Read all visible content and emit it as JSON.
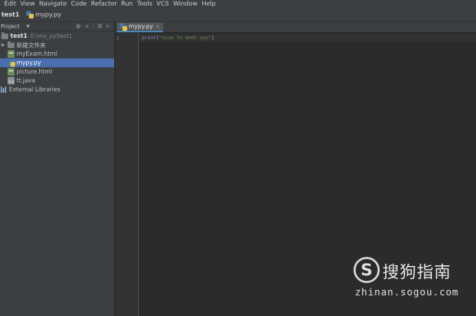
{
  "menu": [
    "Edit",
    "View",
    "Navigate",
    "Code",
    "Refactor",
    "Run",
    "Tools",
    "VCS",
    "Window",
    "Help"
  ],
  "nav": {
    "project": "test1",
    "file": "mypy.py"
  },
  "project_panel": {
    "title": "Project",
    "root": {
      "name": "test1",
      "path": "D:\\my_py\\test1"
    },
    "items": [
      {
        "label": "新建文件夹",
        "kind": "folder"
      },
      {
        "label": "myExam.html",
        "kind": "html"
      },
      {
        "label": "mypy.py",
        "kind": "python",
        "selected": true
      },
      {
        "label": "picture.html",
        "kind": "html"
      },
      {
        "label": "tt.java",
        "kind": "java"
      }
    ],
    "external": "External Libraries",
    "tool_icons": [
      "target-icon",
      "split-icon",
      "gear-icon",
      "collapse-icon"
    ]
  },
  "editor": {
    "tab": "mypy.py",
    "line_number": "1",
    "code_fn": "print",
    "code_open": "(",
    "code_str": "\"nice to meet you\"",
    "code_close": ")"
  },
  "watermark": {
    "logo": "S",
    "name": "搜狗指南",
    "url": "zhinan.sogou.com"
  },
  "colors": {
    "selection": "#4b6eaf",
    "panel": "#3c3f41",
    "editor": "#2b2b2b"
  }
}
